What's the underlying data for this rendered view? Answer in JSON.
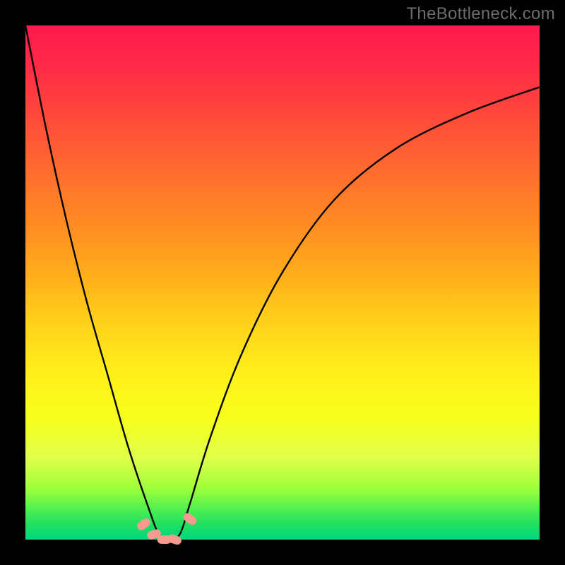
{
  "watermark": "TheBottleneck.com",
  "colors": {
    "frame": "#000000",
    "curve_stroke": "#000000",
    "marker_fill": "#f89a8e",
    "marker_stroke": "#d77865",
    "gradient_stops": [
      {
        "stop": 0.0,
        "hex": "#ff1a4d"
      },
      {
        "stop": 0.18,
        "hex": "#ff4a3a"
      },
      {
        "stop": 0.38,
        "hex": "#ff8a24"
      },
      {
        "stop": 0.58,
        "hex": "#ffd21a"
      },
      {
        "stop": 0.76,
        "hex": "#f8ff1a"
      },
      {
        "stop": 0.9,
        "hex": "#a0ff3a"
      },
      {
        "stop": 1.0,
        "hex": "#00d880"
      }
    ]
  },
  "chart_data": {
    "type": "line",
    "title": "",
    "xlabel": "",
    "ylabel": "",
    "xlim": [
      0,
      100
    ],
    "ylim": [
      0,
      100
    ],
    "note": "Bottleneck-style V-curve. x is a normalized component ratio (0–100), y is estimated bottleneck percentage (0 at minimum, 100 at top). Curve minimum near x≈28. Markers denote the cluster of near-zero-bottleneck points around the trough.",
    "series": [
      {
        "name": "bottleneck_curve",
        "x": [
          0,
          4,
          8,
          12,
          16,
          20,
          24,
          26,
          28,
          30,
          32,
          36,
          42,
          50,
          60,
          72,
          86,
          100
        ],
        "y": [
          100,
          80,
          62,
          46,
          32,
          18,
          6,
          1,
          0,
          1,
          7,
          20,
          36,
          52,
          66,
          76,
          83,
          88
        ]
      }
    ],
    "markers": [
      {
        "x": 23,
        "y": 3
      },
      {
        "x": 25,
        "y": 1
      },
      {
        "x": 27,
        "y": 0
      },
      {
        "x": 29,
        "y": 0
      },
      {
        "x": 32,
        "y": 4
      }
    ]
  }
}
